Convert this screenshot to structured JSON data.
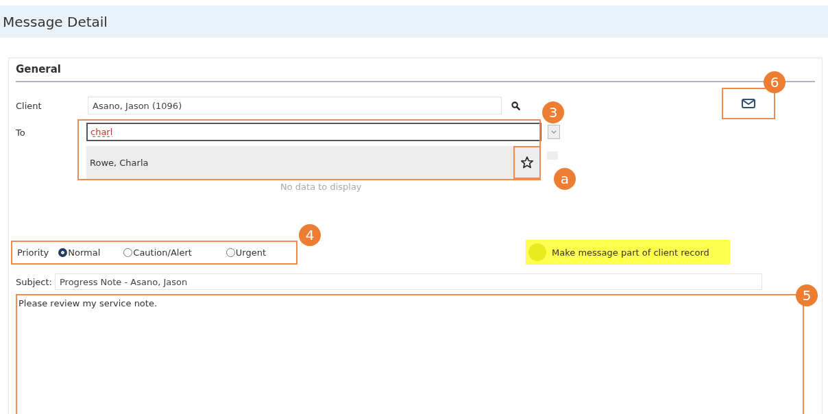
{
  "window": {
    "title": "Message Detail"
  },
  "section": {
    "title": "General"
  },
  "client": {
    "label": "Client",
    "value": "Asano, Jason (1096)"
  },
  "to": {
    "label": "To",
    "value": "charl",
    "suggestions": [
      {
        "name": "Rowe, Charla"
      }
    ],
    "empty_text": "No data to display"
  },
  "priority": {
    "label": "Priority",
    "options": [
      {
        "label": "Normal",
        "selected": true
      },
      {
        "label": "Caution/Alert",
        "selected": false
      },
      {
        "label": "Urgent",
        "selected": false
      }
    ]
  },
  "record_checkbox": {
    "label": "Make message part of client record",
    "checked": false
  },
  "subject": {
    "label": "Subject:",
    "value": "Progress Note - Asano, Jason"
  },
  "body": {
    "value": "Please review my service note."
  },
  "callouts": {
    "to": "3",
    "favorite": "a",
    "send": "6",
    "priority": "4",
    "body": "5"
  }
}
